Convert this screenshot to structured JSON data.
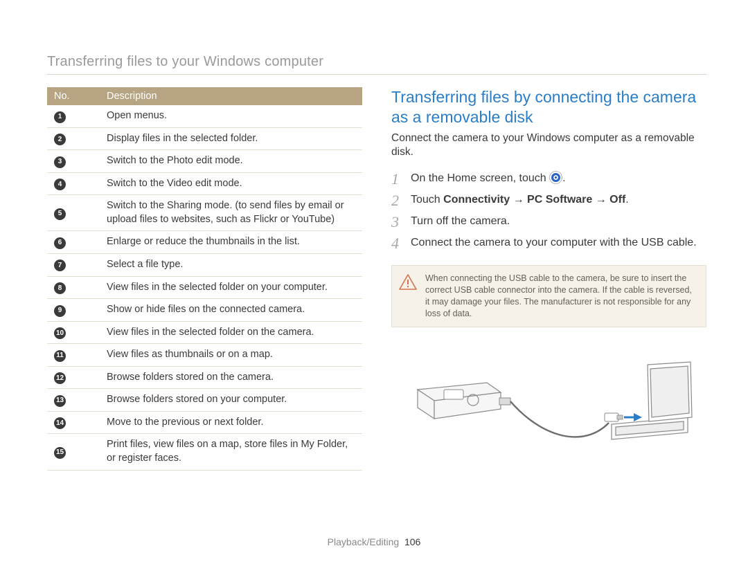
{
  "header": {
    "running_title": "Transferring files to your Windows computer"
  },
  "table": {
    "head_no": "No.",
    "head_desc": "Description",
    "rows": [
      {
        "n": "1",
        "d": "Open menus."
      },
      {
        "n": "2",
        "d": "Display files in the selected folder."
      },
      {
        "n": "3",
        "d": "Switch to the Photo edit mode."
      },
      {
        "n": "4",
        "d": "Switch to the Video edit mode."
      },
      {
        "n": "5",
        "d": "Switch to the Sharing mode. (to send files by email or upload files to websites, such as Flickr or YouTube)"
      },
      {
        "n": "6",
        "d": "Enlarge or reduce the thumbnails in the list."
      },
      {
        "n": "7",
        "d": "Select a file type."
      },
      {
        "n": "8",
        "d": "View files in the selected folder on your computer."
      },
      {
        "n": "9",
        "d": "Show or hide files on the connected camera."
      },
      {
        "n": "10",
        "d": "View files in the selected folder on the camera."
      },
      {
        "n": "11",
        "d": "View files as thumbnails or on a map."
      },
      {
        "n": "12",
        "d": "Browse folders stored on the camera."
      },
      {
        "n": "13",
        "d": "Browse folders stored on your computer."
      },
      {
        "n": "14",
        "d": "Move to the previous or next folder."
      },
      {
        "n": "15",
        "d": "Print files, view files on a map, store files in My Folder, or register faces."
      }
    ]
  },
  "section": {
    "title": "Transferring files by connecting the camera as a removable disk",
    "intro": "Connect the camera to your Windows computer as a removable disk.",
    "steps": {
      "s1_prefix": "On the Home screen, touch ",
      "s1_suffix": ".",
      "s2_prefix": "Touch ",
      "s2_bold": "Connectivity → PC Software → Off",
      "s2_suffix": ".",
      "s3": "Turn off the camera.",
      "s4": "Connect the camera to your computer with the USB cable."
    },
    "caution": "When connecting the USB cable to the camera, be sure to insert the correct USB cable connector into the camera. If the cable is reversed, it may damage your files. The manufacturer is not responsible for any loss of data."
  },
  "footer": {
    "section": "Playback/Editing",
    "page": "106"
  },
  "icons": {
    "home": "home-icon",
    "caution": "warning-triangle-icon"
  }
}
